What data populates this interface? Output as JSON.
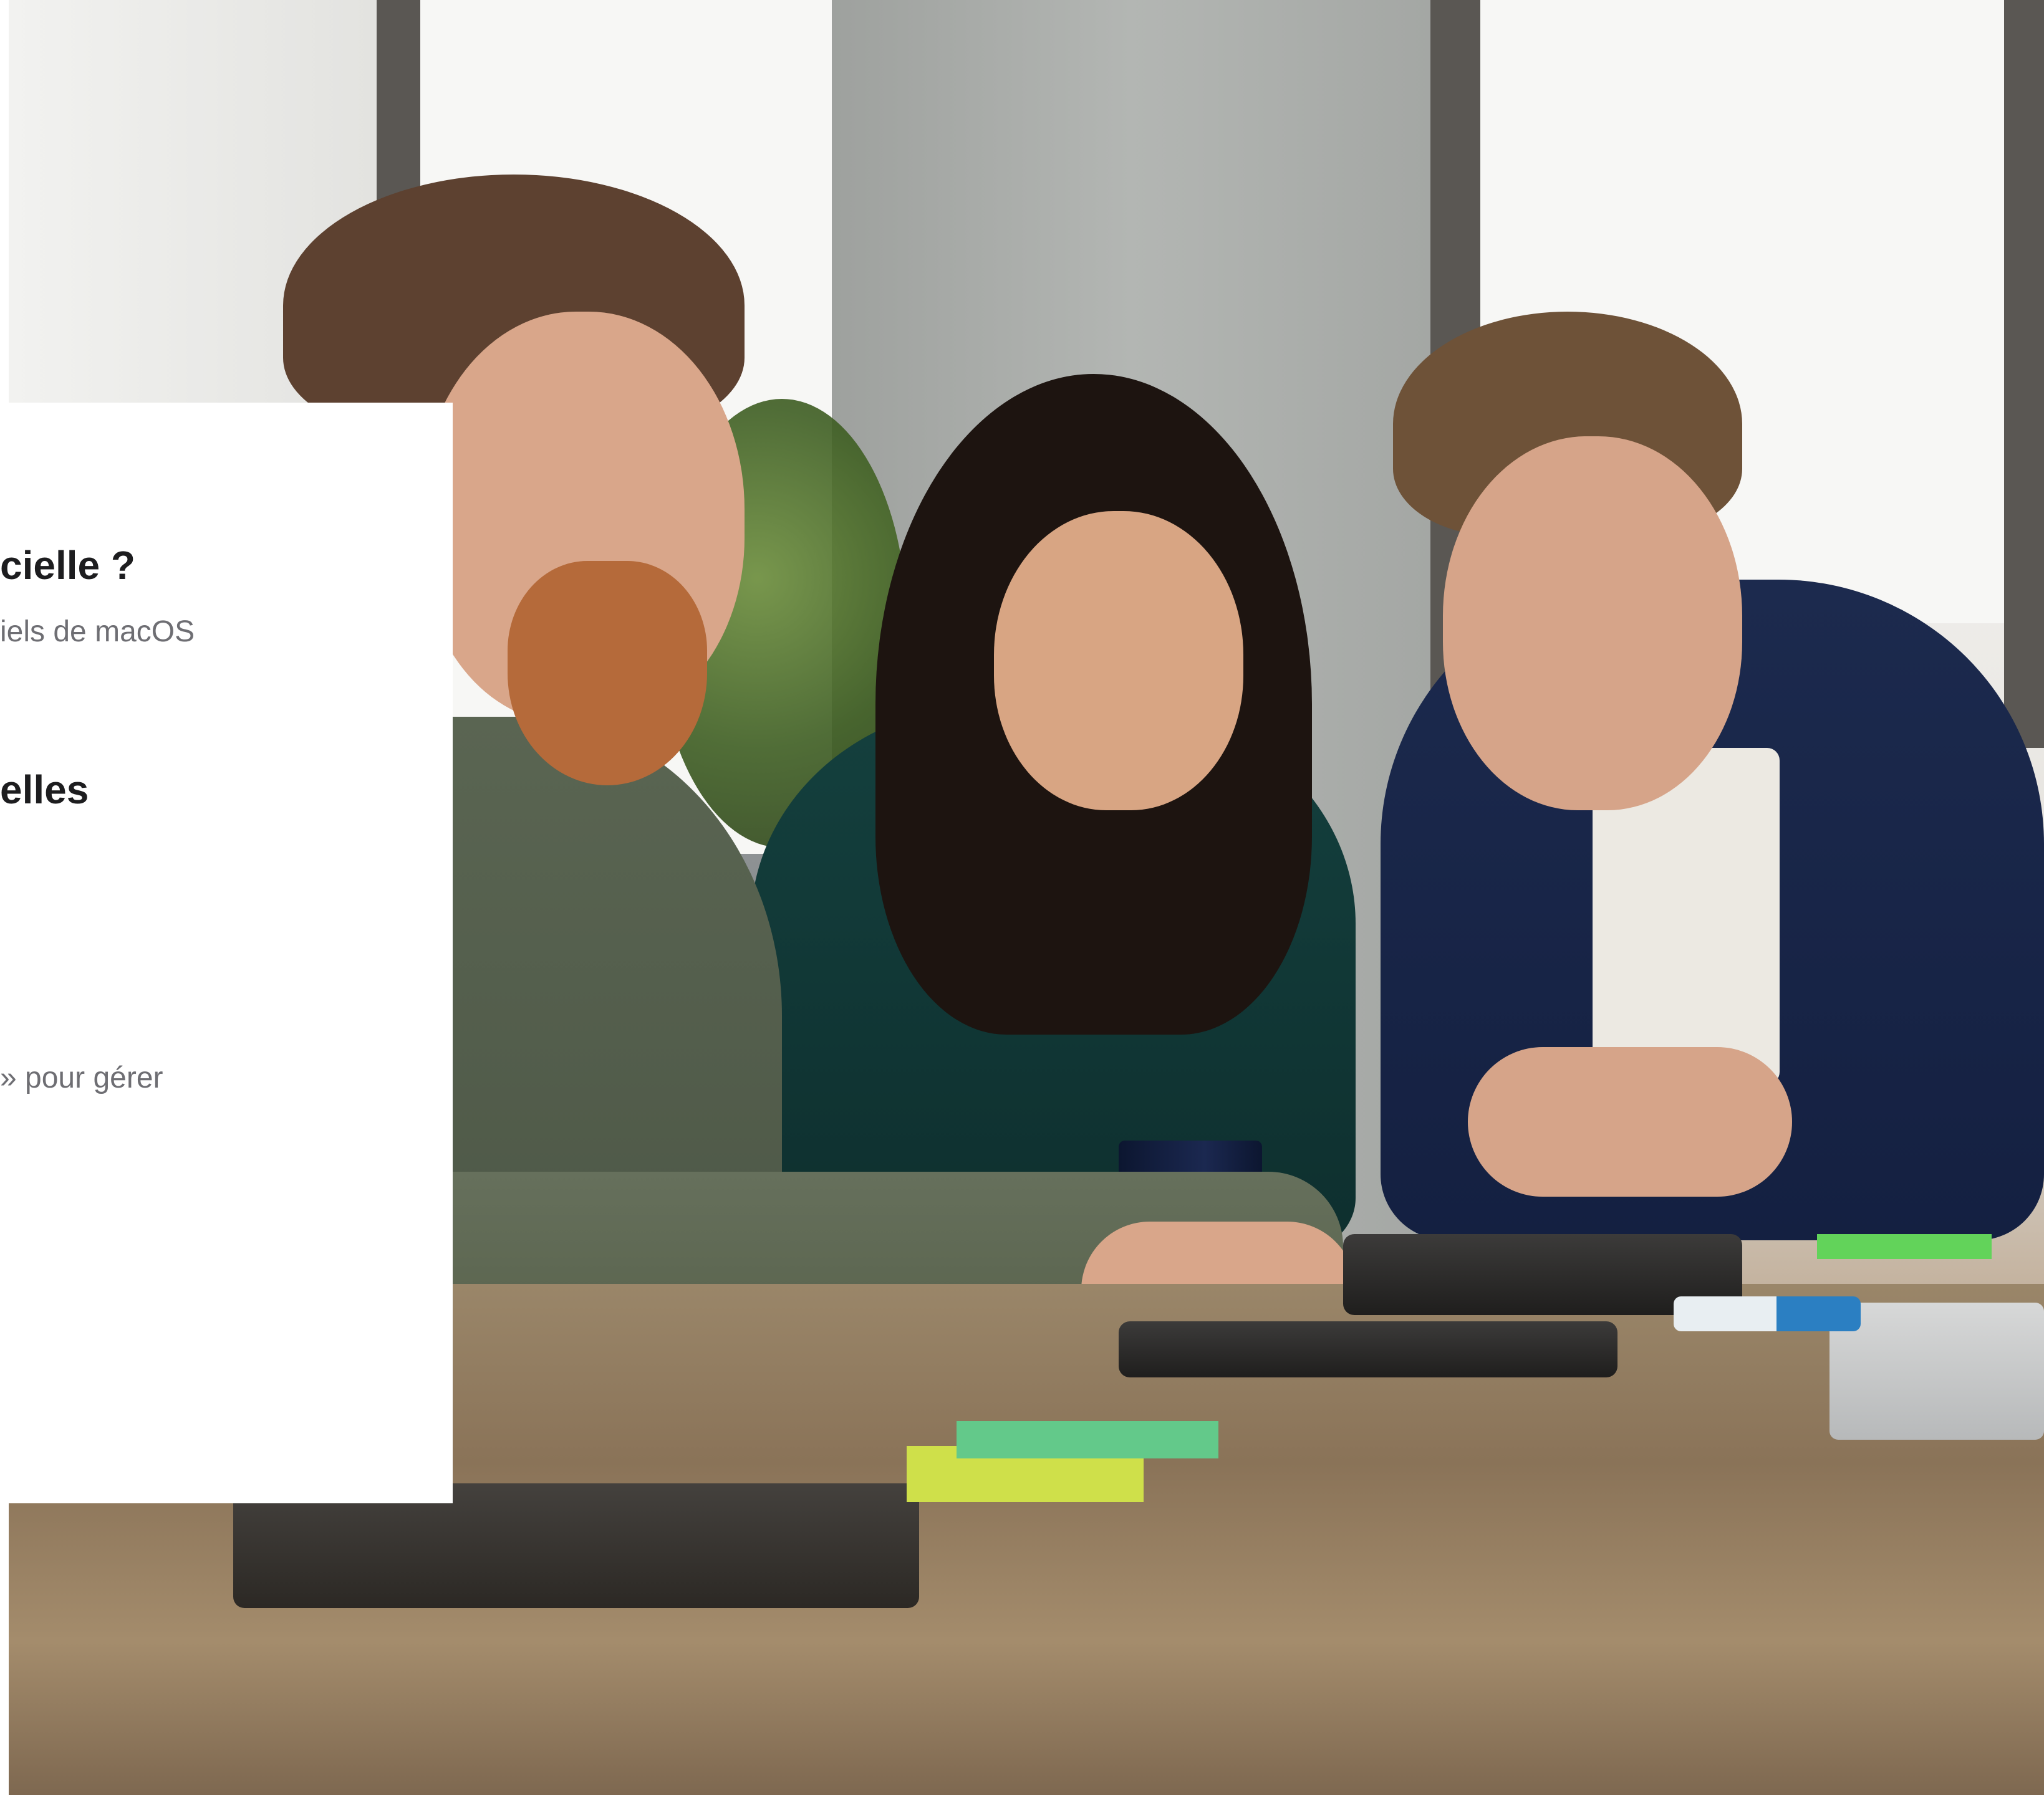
{
  "card": {
    "heading_1": "cielle ?",
    "text_1": "iels de macOS",
    "heading_2": "elles",
    "text_2": "» pour gérer"
  }
}
